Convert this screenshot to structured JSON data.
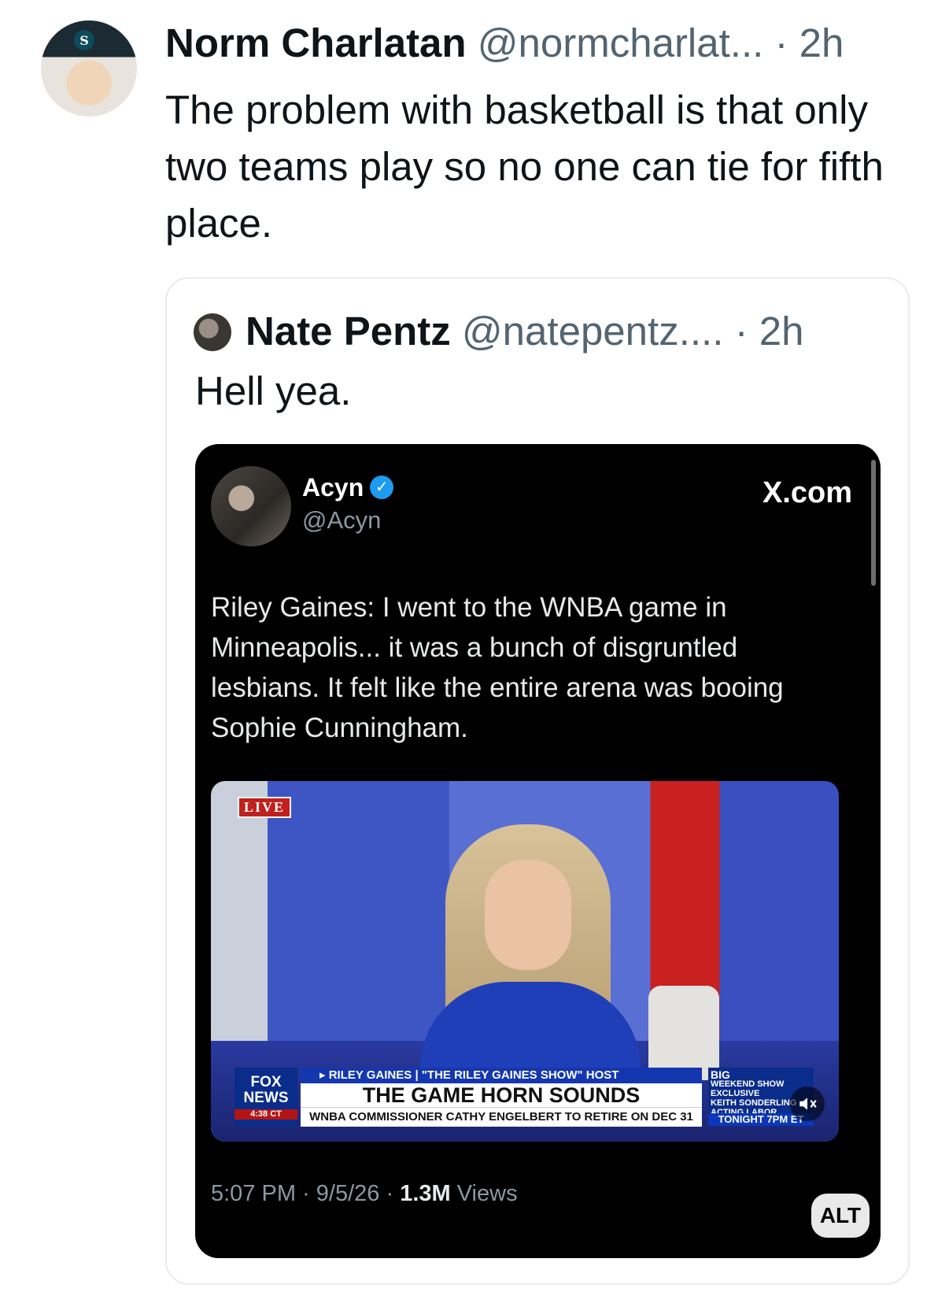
{
  "tweet": {
    "author_name": "Norm Charlatan",
    "author_handle": "@normcharlat...",
    "separator": "·",
    "time": "2h",
    "text": "The problem with basketball is that only two teams play so no one can tie for fifth place."
  },
  "quoted_tweet": {
    "author_name": "Nate Pentz",
    "author_handle": "@natepentz....",
    "separator": "·",
    "time": "2h",
    "text": "Hell yea.",
    "media": {
      "inner_post": {
        "author_name": "Acyn",
        "author_handle": "@Acyn",
        "verified": true,
        "brand": "X.com",
        "text": "Riley Gaines: I went to the WNBA game in Minneapolis... it was a bunch of disgruntled lesbians. It felt like the entire arena was booing Sophie Cunningham.",
        "timestamp": "5:07 PM · 9/5/26 ·",
        "views_count": "1.3M",
        "views_label": "Views"
      },
      "video": {
        "live_label": "LIVE",
        "network_line1": "FOX",
        "network_line2": "NEWS",
        "clock": "4:38 CT",
        "strap": "▸ RILEY GAINES | \"THE RILEY GAINES SHOW\" HOST",
        "headline": "THE GAME HORN SOUNDS",
        "ticker": "WNBA COMMISSIONER CATHY ENGELBERT TO RETIRE ON DEC 31",
        "promo_title": "BIG",
        "promo_sub": "WEEKEND SHOW",
        "promo_exclusive": "EXCLUSIVE",
        "promo_guest": "KEITH SONDERLING",
        "promo_role": "ACTING LABOR SECRETARY",
        "promo_time": "TONIGHT 7PM ET"
      },
      "alt_label": "ALT"
    }
  },
  "colors": {
    "text": "#0f1419",
    "muted": "#536471",
    "card_border": "#e6ecf0",
    "verified": "#1d9bf0",
    "live_red": "#c0201e",
    "fox_blue": "#0a2c8a"
  },
  "icons": [
    "verified-badge-icon",
    "mute-icon"
  ]
}
